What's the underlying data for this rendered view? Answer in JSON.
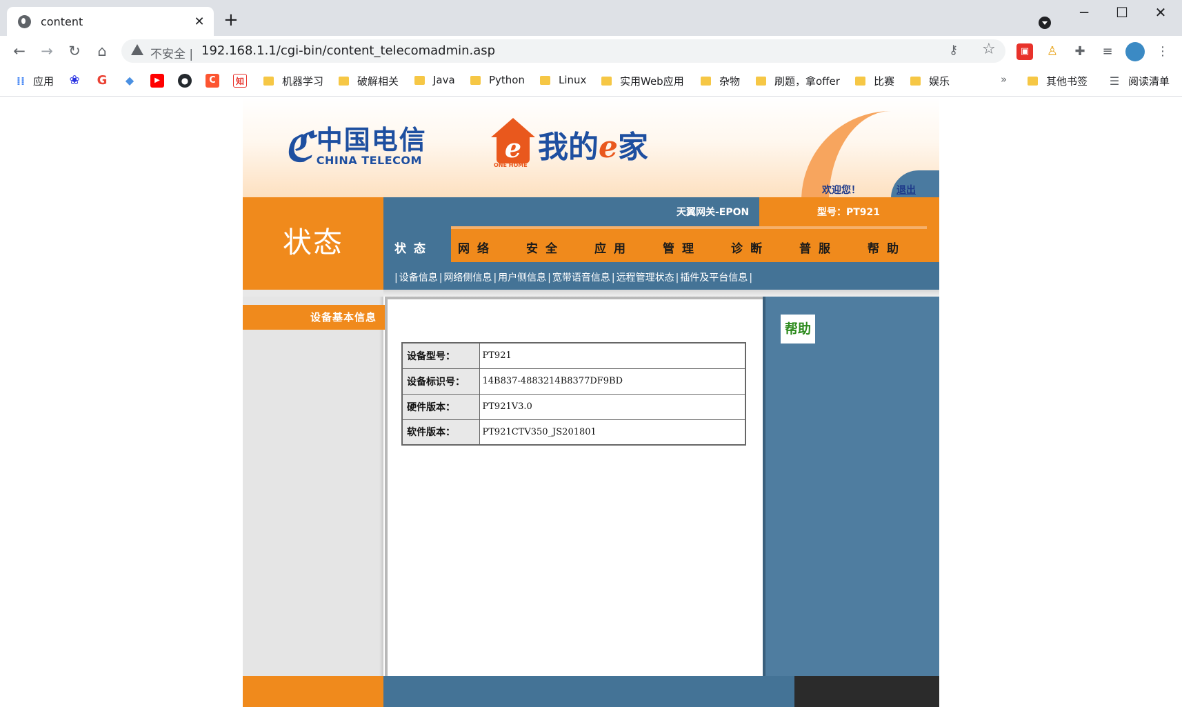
{
  "browser": {
    "tab_title": "content",
    "tab_close": "✕",
    "new_tab": "+",
    "address": {
      "security_label": "不安全",
      "separator": "|",
      "url": "192.168.1.1/cgi-bin/content_telecomadmin.asp"
    },
    "bookmarks": [
      {
        "label": "应用",
        "icon": "apps-grid-icon",
        "color": "#4285f4"
      },
      {
        "label": "",
        "icon": "baidu-icon",
        "color": "#2932e1"
      },
      {
        "label": "",
        "icon": "google-icon",
        "color": "#ea4335"
      },
      {
        "label": "",
        "icon": "graduation-cap-icon",
        "color": "#4a90e2"
      },
      {
        "label": "",
        "icon": "youtube-icon",
        "color": "#ff0000"
      },
      {
        "label": "",
        "icon": "github-icon",
        "color": "#24292e"
      },
      {
        "label": "",
        "icon": "csdn-icon",
        "color": "#fc5531"
      },
      {
        "label": "",
        "icon": "zhihu-icon",
        "color": "#e8322b"
      },
      {
        "label": "机器学习",
        "icon": "folder-icon"
      },
      {
        "label": "破解相关",
        "icon": "folder-icon"
      },
      {
        "label": "Java",
        "icon": "folder-icon"
      },
      {
        "label": "Python",
        "icon": "folder-icon"
      },
      {
        "label": "Linux",
        "icon": "folder-icon"
      },
      {
        "label": "实用Web应用",
        "icon": "folder-icon"
      },
      {
        "label": "杂物",
        "icon": "folder-icon"
      },
      {
        "label": "刷题，拿offer",
        "icon": "folder-icon"
      },
      {
        "label": "比赛",
        "icon": "folder-icon"
      },
      {
        "label": "娱乐",
        "icon": "folder-icon"
      }
    ],
    "bookmarks_more": "»",
    "other_bookmarks": "其他书签",
    "reading_list": "阅读清单"
  },
  "router": {
    "brand_cn": "中国电信",
    "brand_en": "CHINA TELECOM",
    "home_title_pre": "我的",
    "home_title_e": "e",
    "home_title_post": "家",
    "house_letter": "e",
    "house_tag": "ONE HOME",
    "welcome": "欢迎您！",
    "logout": "退出",
    "section_title": "状态",
    "gateway_name": "天翼网关-EPON",
    "model_label": "型号：PT921",
    "menu": [
      "状态",
      "网络",
      "安全",
      "应用",
      "管理",
      "诊断",
      "普服",
      "帮助"
    ],
    "submenu": [
      "设备信息",
      "网络侧信息",
      "用户侧信息",
      "宽带语音信息",
      "远程管理状态",
      "插件及平台信息"
    ],
    "sidebar_item": "设备基本信息",
    "help_label": "帮助",
    "device_info": [
      {
        "label": "设备型号：",
        "value": "PT921"
      },
      {
        "label": "设备标识号：",
        "value": "14B837-4883214B8377DF9BD"
      },
      {
        "label": "硬件版本：",
        "value": "PT921V3.0"
      },
      {
        "label": "软件版本：",
        "value": "PT921CTV350_JS201801"
      }
    ]
  },
  "colors": {
    "orange": "#f08a1c",
    "blue": "#447396",
    "help_green": "#2e8b1e"
  }
}
